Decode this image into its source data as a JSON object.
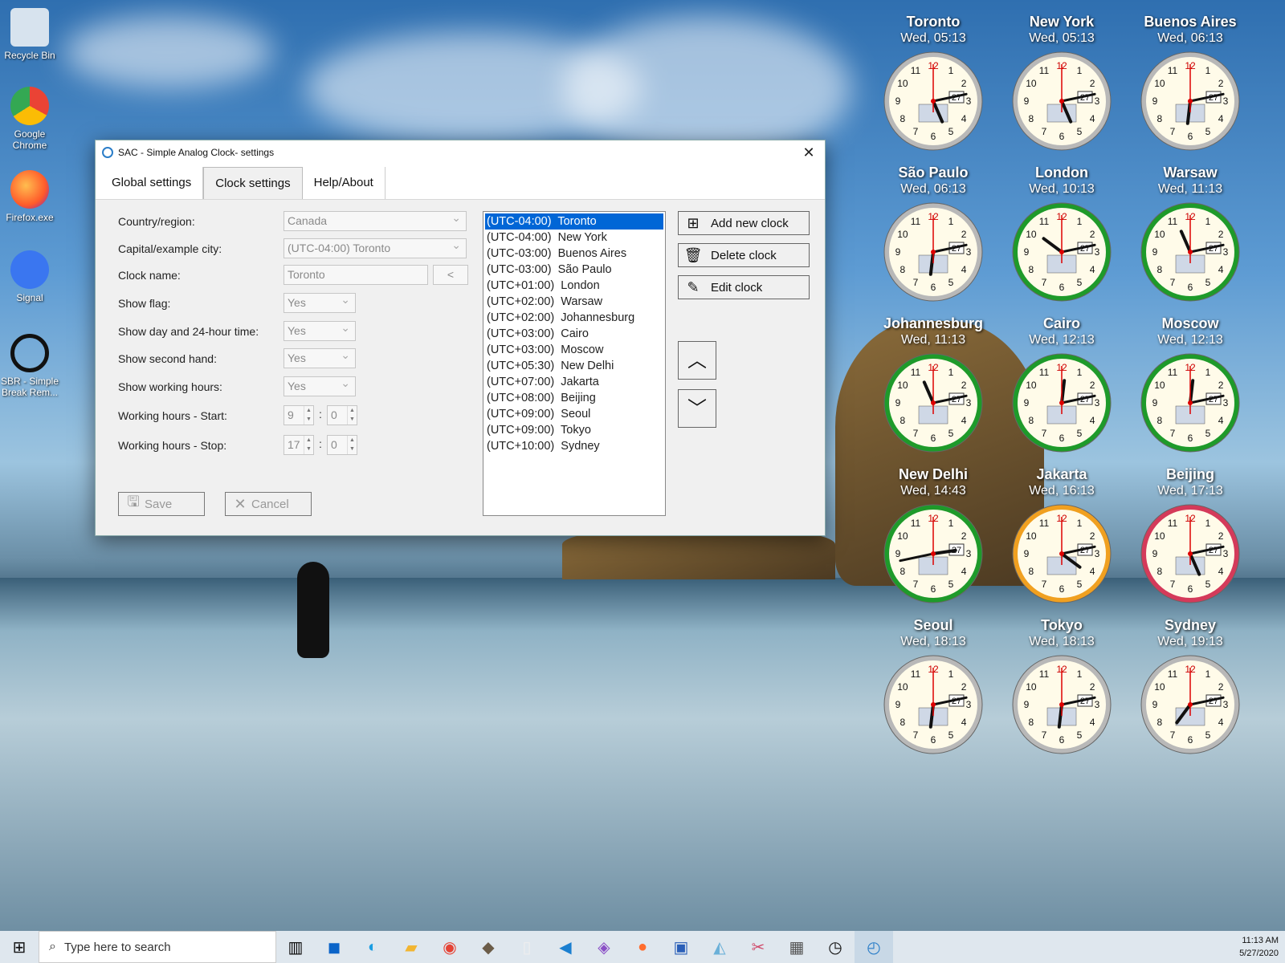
{
  "desktop": {
    "icons": [
      {
        "label": "Recycle Bin"
      },
      {
        "label": "Google Chrome"
      },
      {
        "label": "Firefox.exe"
      },
      {
        "label": "Signal"
      },
      {
        "label": "SBR - Simple Break Rem..."
      }
    ]
  },
  "clocks": [
    {
      "city": "Toronto",
      "time": "Wed, 05:13",
      "date_box": "27",
      "ring": "silver"
    },
    {
      "city": "New York",
      "time": "Wed, 05:13",
      "date_box": "27",
      "ring": "silver"
    },
    {
      "city": "Buenos Aires",
      "time": "Wed, 06:13",
      "date_box": "27",
      "ring": "silver"
    },
    {
      "city": "São Paulo",
      "time": "Wed, 06:13",
      "date_box": "27",
      "ring": "silver"
    },
    {
      "city": "London",
      "time": "Wed, 10:13",
      "date_box": "27",
      "ring": "green"
    },
    {
      "city": "Warsaw",
      "time": "Wed, 11:13",
      "date_box": "27",
      "ring": "green"
    },
    {
      "city": "Johannesburg",
      "time": "Wed, 11:13",
      "date_box": "27",
      "ring": "green"
    },
    {
      "city": "Cairo",
      "time": "Wed, 12:13",
      "date_box": "27",
      "ring": "green"
    },
    {
      "city": "Moscow",
      "time": "Wed, 12:13",
      "date_box": "27",
      "ring": "green"
    },
    {
      "city": "New Delhi",
      "time": "Wed, 14:43",
      "date_box": "27",
      "ring": "green"
    },
    {
      "city": "Jakarta",
      "time": "Wed, 16:13",
      "date_box": "27",
      "ring": "orange"
    },
    {
      "city": "Beijing",
      "time": "Wed, 17:13",
      "date_box": "27",
      "ring": "red"
    },
    {
      "city": "Seoul",
      "time": "Wed, 18:13",
      "date_box": "27",
      "ring": "silver"
    },
    {
      "city": "Tokyo",
      "time": "Wed, 18:13",
      "date_box": "27",
      "ring": "silver"
    },
    {
      "city": "Sydney",
      "time": "Wed, 19:13",
      "date_box": "27",
      "ring": "silver"
    }
  ],
  "window": {
    "title": "SAC - Simple Analog Clock- settings",
    "tabs": [
      "Global settings",
      "Clock settings",
      "Help/About"
    ],
    "form": {
      "country_label": "Country/region:",
      "country_value": "Canada",
      "capital_label": "Capital/example city:",
      "capital_value": "(UTC-04:00) Toronto",
      "name_label": "Clock name:",
      "name_value": "Toronto",
      "name_button": "<",
      "flag_label": "Show flag:",
      "flag_value": "Yes",
      "day_label": "Show day and 24-hour time:",
      "day_value": "Yes",
      "second_label": "Show second hand:",
      "second_value": "Yes",
      "working_label": "Show working hours:",
      "working_value": "Yes",
      "start_label": "Working hours - Start:",
      "start_h": "9",
      "start_m": "0",
      "stop_label": "Working hours - Stop:",
      "stop_h": "17",
      "stop_m": "0",
      "colon": ":"
    },
    "save_label": "Save",
    "cancel_label": "Cancel",
    "list": [
      "(UTC-04:00)  Toronto",
      "(UTC-04:00)  New York",
      "(UTC-03:00)  Buenos Aires",
      "(UTC-03:00)  São Paulo",
      "(UTC+01:00)  London",
      "(UTC+02:00)  Warsaw",
      "(UTC+02:00)  Johannesburg",
      "(UTC+03:00)  Cairo",
      "(UTC+03:00)  Moscow",
      "(UTC+05:30)  New Delhi",
      "(UTC+07:00)  Jakarta",
      "(UTC+08:00)  Beijing",
      "(UTC+09:00)  Seoul",
      "(UTC+09:00)  Tokyo",
      "(UTC+10:00)  Sydney"
    ],
    "add_label": "Add new clock",
    "delete_label": "Delete clock",
    "edit_label": "Edit clock"
  },
  "taskbar": {
    "search_placeholder": "Type here to search",
    "time": "11:13 AM",
    "date": "5/27/2020"
  },
  "colors": {
    "silver": "#b8b8b8",
    "green": "#1e9a2a",
    "orange": "#f0a020",
    "red": "#d43a5a",
    "accent": "#0066d6"
  }
}
